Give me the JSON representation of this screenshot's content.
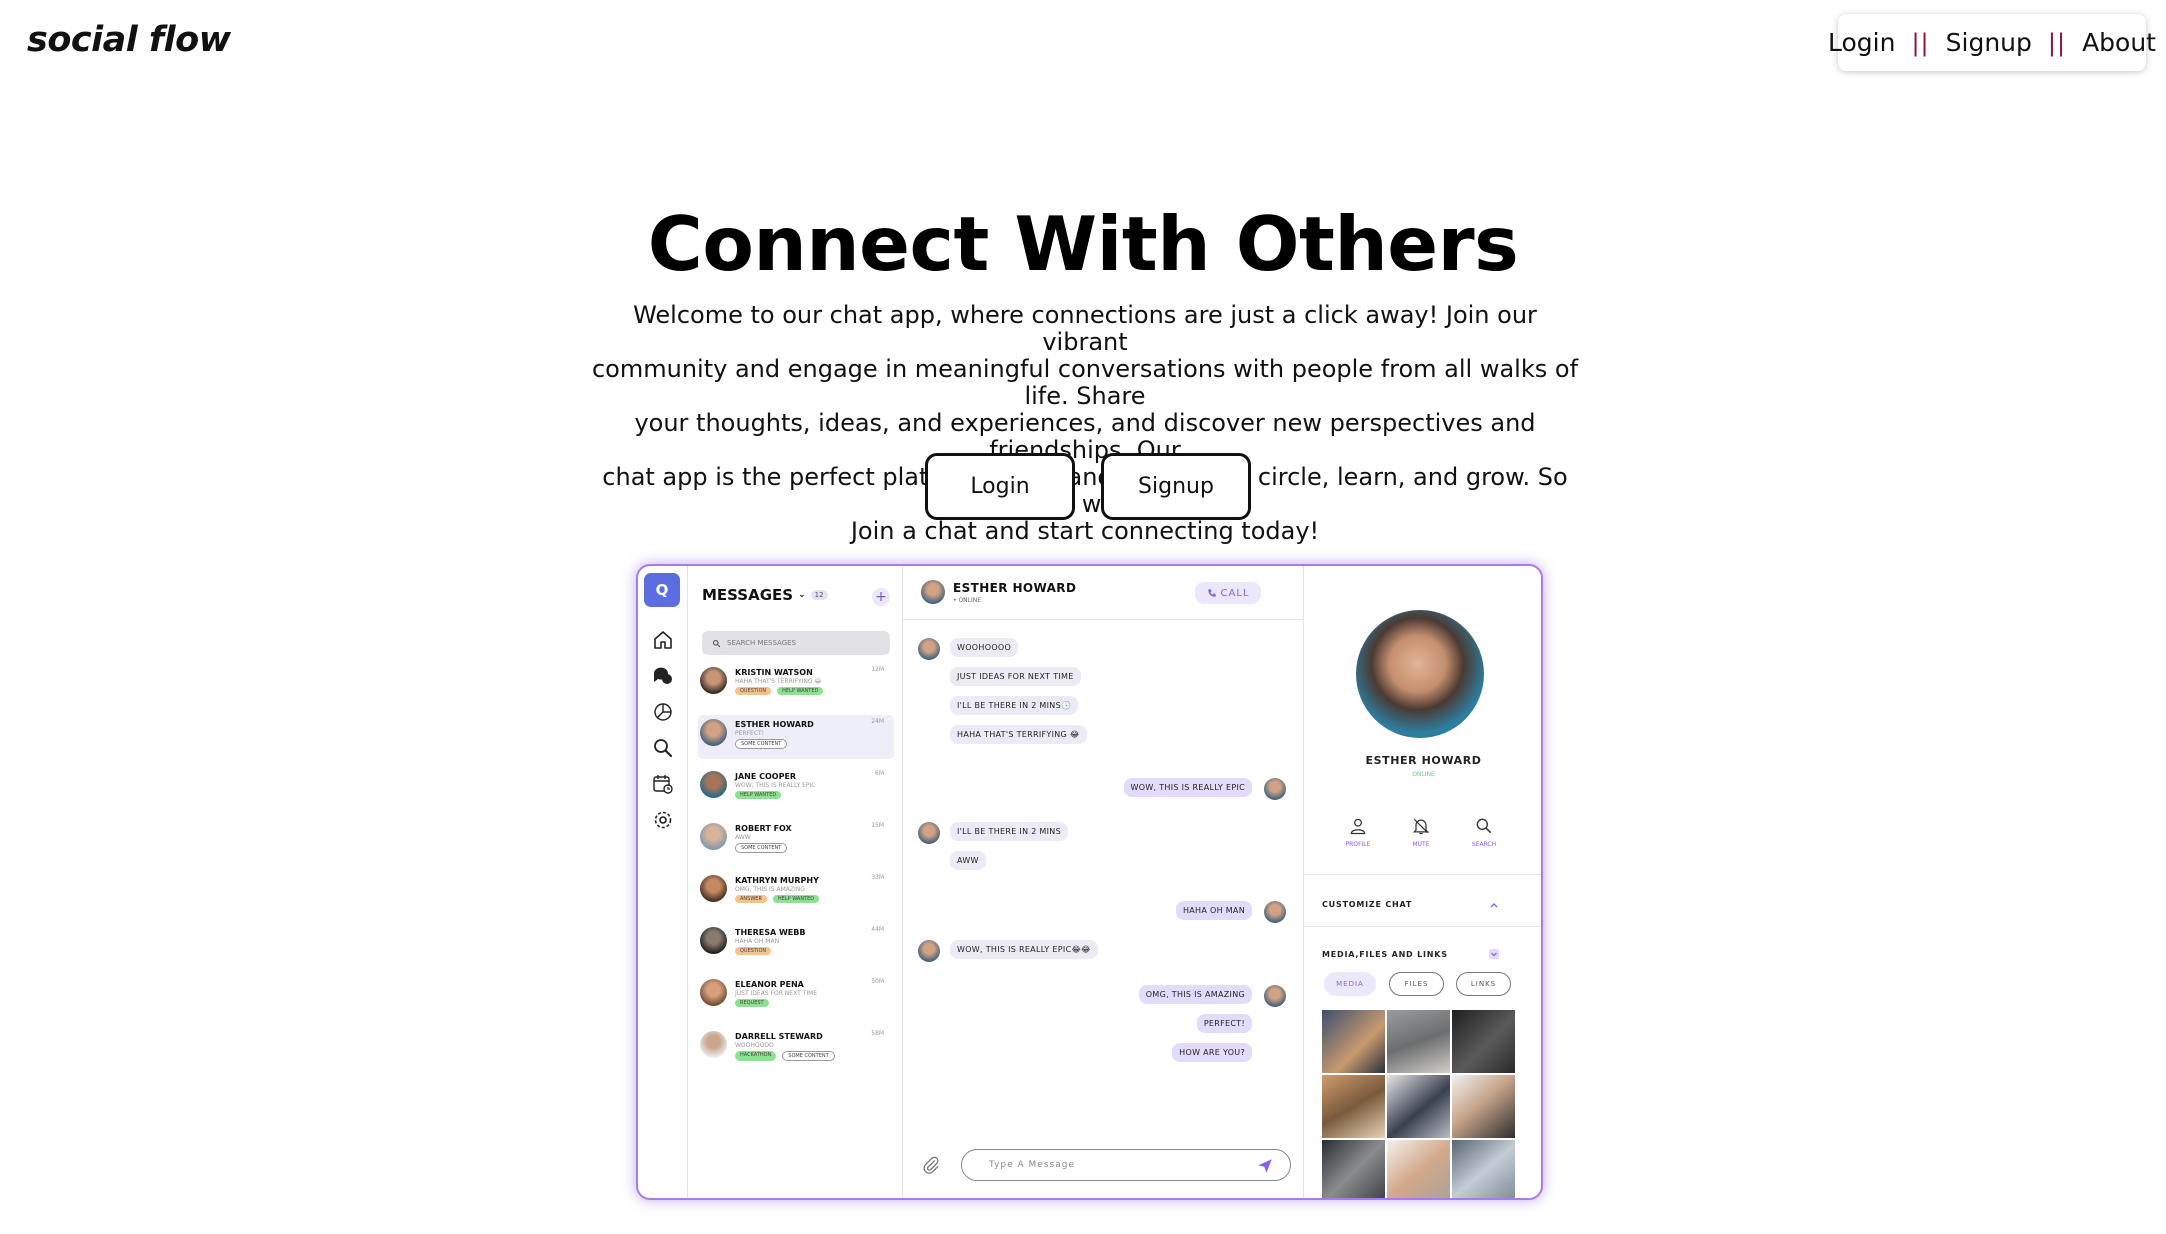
{
  "header": {
    "logo": "social flow",
    "nav": {
      "login": "Login",
      "sep1": "||",
      "signup": "Signup",
      "sep2": "||",
      "about": "About"
    }
  },
  "hero": {
    "title": "Connect With Others",
    "lines": [
      "Welcome to our chat app, where connections are just a click away! Join our vibrant",
      "community and engage in meaningful conversations with people from all walks of life. Share",
      "your thoughts, ideas, and experiences, and discover new perspectives and friendships. Our",
      "chat app is the perfect platform to expand your social circle, learn, and grow. So why wait?",
      "Join a chat and start connecting today!"
    ],
    "login_button": "Login",
    "signup_button": "Signup"
  },
  "mockup": {
    "logo_letter": "Q",
    "messages": {
      "title": "MESSAGES",
      "count": "12",
      "plus": "+",
      "search_placeholder": "SEARCH MESSAGES",
      "items": [
        {
          "name": "KRISTIN WATSON",
          "preview": "HAHA THAT'S TERRIFYING 😂",
          "time": "12M",
          "tags": [
            {
              "label": "QUESTION",
              "kind": "orange"
            },
            {
              "label": "HELP WANTED",
              "kind": "green"
            }
          ]
        },
        {
          "name": "ESTHER HOWARD",
          "preview": "PERFECT!",
          "time": "24M",
          "tags": [
            {
              "label": "SOME CONTENT",
              "kind": "outline"
            }
          ]
        },
        {
          "name": "JANE COOPER",
          "preview": "WOW, THIS IS REALLY EPIC",
          "time": "6M",
          "tags": [
            {
              "label": "HELP WANTED",
              "kind": "green"
            }
          ]
        },
        {
          "name": "ROBERT FOX",
          "preview": "AWW",
          "time": "15M",
          "tags": [
            {
              "label": "SOME CONTENT",
              "kind": "outline"
            }
          ]
        },
        {
          "name": "KATHRYN MURPHY",
          "preview": "OMG, THIS IS AMAZING",
          "time": "33M",
          "tags": [
            {
              "label": "ANSWER",
              "kind": "orange"
            },
            {
              "label": "HELP WANTED",
              "kind": "green"
            }
          ]
        },
        {
          "name": "THERESA WEBB",
          "preview": "HAHA OH MAN",
          "time": "44M",
          "tags": [
            {
              "label": "QUESTION",
              "kind": "orange"
            }
          ]
        },
        {
          "name": "ELEANOR PENA",
          "preview": "JUST IDEAS FOR NEXT TIME",
          "time": "50M",
          "tags": [
            {
              "label": "REQUEST",
              "kind": "green"
            }
          ]
        },
        {
          "name": "DARRELL STEWARD",
          "preview": "WOOHOOOO",
          "time": "58M",
          "tags": [
            {
              "label": "HACKATHON",
              "kind": "green"
            },
            {
              "label": "SOME CONTENT",
              "kind": "outline"
            }
          ]
        }
      ]
    },
    "chat": {
      "name": "ESTHER HOWARD",
      "status": "• ONLINE",
      "call": "CALL",
      "input_placeholder": "Type A Message",
      "messages": [
        {
          "text": "WOOHOOOO",
          "dir": "in"
        },
        {
          "text": "JUST IDEAS FOR NEXT TIME",
          "dir": "in"
        },
        {
          "text": "I'LL BE THERE IN 2 MINS🕓",
          "dir": "in"
        },
        {
          "text": "HAHA THAT'S TERRIFYING 😂",
          "dir": "in"
        },
        {
          "text": "WOW, THIS IS REALLY EPIC",
          "dir": "out"
        },
        {
          "text": "I'LL BE THERE IN 2 MINS",
          "dir": "in"
        },
        {
          "text": "AWW",
          "dir": "in"
        },
        {
          "text": "HAHA OH MAN",
          "dir": "out"
        },
        {
          "text": "WOW, THIS IS REALLY EPIC😂😂",
          "dir": "in"
        },
        {
          "text": "OMG, THIS IS AMAZING",
          "dir": "out"
        },
        {
          "text": "PERFECT!",
          "dir": "out"
        },
        {
          "text": "HOW ARE YOU?",
          "dir": "out"
        }
      ]
    },
    "profile": {
      "name": "ESTHER HOWARD",
      "status": "ONLINE",
      "actions": {
        "profile": "PROFILE",
        "mute": "MUTE",
        "search": "SEARCH"
      },
      "customize": "CUSTOMIZE CHAT",
      "media_section": "MEDIA,FILES AND LINKS",
      "filters": {
        "media": "MEDIA",
        "files": "FILES",
        "links": "LINKS"
      }
    }
  },
  "colors": {
    "accent": "#8b5cf6",
    "mock_border": "#a77ce8",
    "app_logo": "#5b6de0",
    "nav_separator": "#8a1545"
  }
}
